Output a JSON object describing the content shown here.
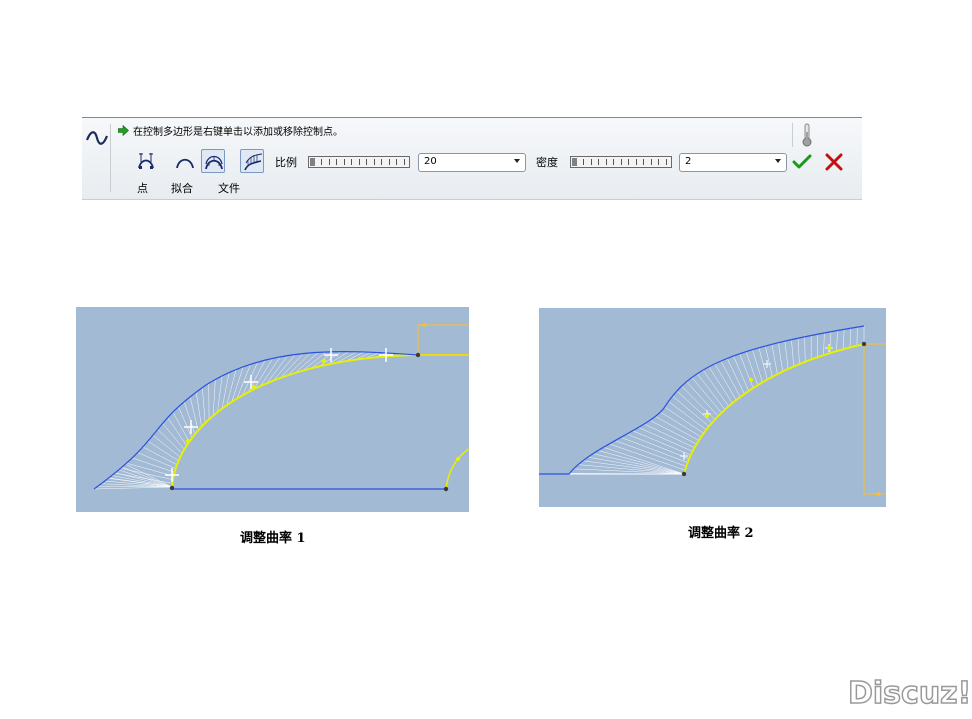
{
  "dashboard": {
    "message": "在控制多边形是右键单击以添加或移除控制点。",
    "tools": [
      {
        "name": "point",
        "label": "点"
      },
      {
        "name": "fit",
        "label": "拟合"
      },
      {
        "name": "file",
        "label": "文件"
      }
    ],
    "ratio_label": "比例",
    "ratio_value": "20",
    "density_label": "密度",
    "density_value": "2"
  },
  "figures": [
    {
      "caption": "调整曲率 1"
    },
    {
      "caption": "调整曲率 2"
    }
  ],
  "watermark": "Discuz!",
  "colors": {
    "viewport_bg": "#a3bad5",
    "original_curve": "#e6f000",
    "modified_curve": "#2a52e0",
    "dimension": "#ffc020",
    "accept": "#1a9a1a",
    "cancel": "#c01010"
  }
}
